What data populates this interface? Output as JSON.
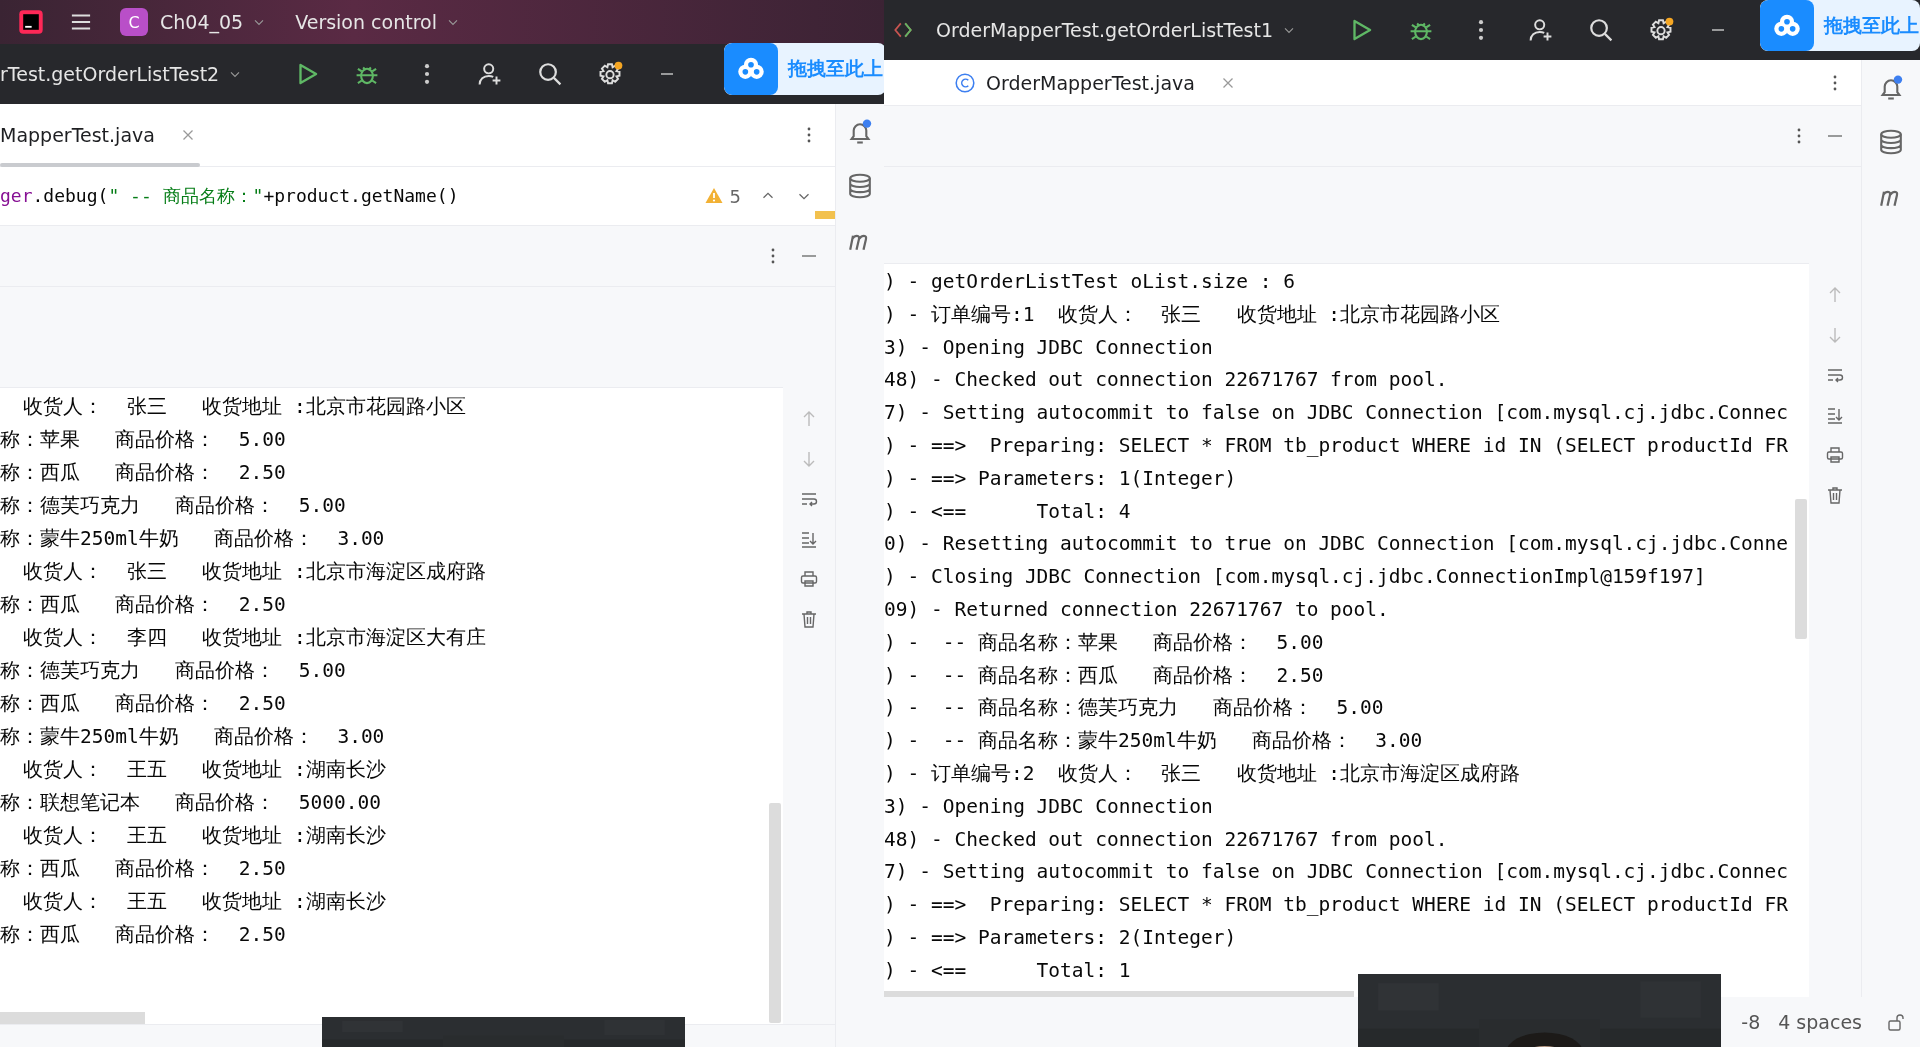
{
  "left_window": {
    "project_icon": "C",
    "project": "Ch04_05",
    "vcs_menu": "Version control",
    "run_config": "rTest.getOrderListTest2",
    "upload_widget": "拖拽至此上",
    "editor_tab": "MapperTest.java",
    "code_line": [
      {
        "kind": "field",
        "text": "ger"
      },
      {
        "kind": "plain",
        "text": ".debug("
      },
      {
        "kind": "string",
        "text": "\" -- 商品名称：\""
      },
      {
        "kind": "plain",
        "text": "+product.getName()"
      }
    ],
    "warning_count": "5",
    "console_lines": [
      "  收货人：  张三   收货地址 :北京市花园路小区",
      "称：苹果   商品价格：  5.00",
      "称：西瓜   商品价格：  2.50",
      "称：德芙巧克力   商品价格：  5.00",
      "称：蒙牛250ml牛奶   商品价格：  3.00",
      "  收货人：  张三   收货地址 :北京市海淀区成府路",
      "称：西瓜   商品价格：  2.50",
      "  收货人：  李四   收货地址 :北京市海淀区大有庄",
      "称：德芙巧克力   商品价格：  5.00",
      "称：西瓜   商品价格：  2.50",
      "称：蒙牛250ml牛奶   商品价格：  3.00",
      "  收货人：  王五   收货地址 :湖南长沙",
      "称：联想笔记本   商品价格：  5000.00",
      "  收货人：  王五   收货地址 :湖南长沙",
      "称：西瓜   商品价格：  2.50",
      "  收货人：  王五   收货地址 :湖南长沙",
      "称：西瓜   商品价格：  2.50"
    ]
  },
  "right_window": {
    "run_config": "OrderMapperTest.getOrderListTest1",
    "upload_widget": "拖拽至此上",
    "editor_tab": "OrderMapperTest.java",
    "console_lines": [
      ") - getOrderListTest oList.size : 6",
      ") - 订单编号:1  收货人：  张三   收货地址 :北京市花园路小区",
      "3) - Opening JDBC Connection",
      "48) - Checked out connection 22671767 from pool.",
      "7) - Setting autocommit to false on JDBC Connection [com.mysql.cj.jdbc.Connec",
      ") - ==>  Preparing: SELECT * FROM tb_product WHERE id IN (SELECT productId FR",
      ") - ==> Parameters: 1(Integer)",
      ") - <==      Total: 4",
      "0) - Resetting autocommit to true on JDBC Connection [com.mysql.cj.jdbc.Conne",
      ") - Closing JDBC Connection [com.mysql.cj.jdbc.ConnectionImpl@159f197]",
      "09) - Returned connection 22671767 to pool.",
      ") -  -- 商品名称：苹果   商品价格：  5.00",
      ") -  -- 商品名称：西瓜   商品价格：  2.50",
      ") -  -- 商品名称：德芙巧克力   商品价格：  5.00",
      ") -  -- 商品名称：蒙牛250ml牛奶   商品价格：  3.00",
      ") - 订单编号:2  收货人：  张三   收货地址 :北京市海淀区成府路",
      "3) - Opening JDBC Connection",
      "48) - Checked out connection 22671767 from pool.",
      "7) - Setting autocommit to false on JDBC Connection [com.mysql.cj.jdbc.Connec",
      ") - ==>  Preparing: SELECT * FROM tb_product WHERE id IN (SELECT productId FR",
      ") - ==> Parameters: 2(Integer)",
      ") - <==      Total: 1"
    ],
    "status_bar": {
      "encoding": "-8",
      "indent": "4 spaces"
    }
  }
}
